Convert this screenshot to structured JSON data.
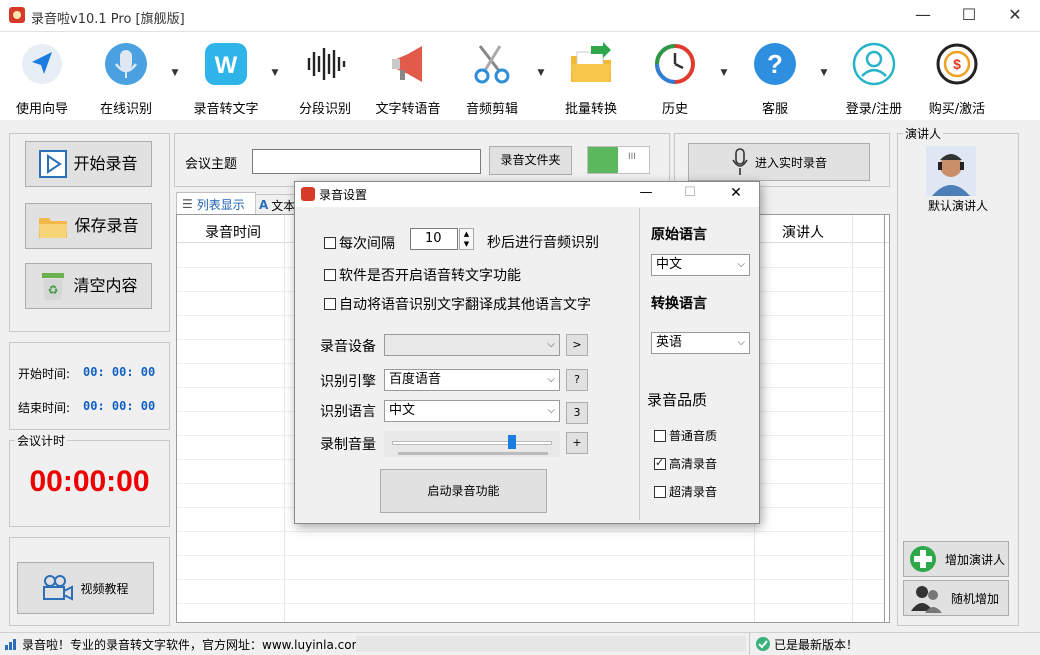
{
  "window": {
    "title": "录音啦v10.1 Pro [旗舰版]",
    "minimize": "—",
    "maximize": "☐",
    "close": "✕"
  },
  "toolbar": {
    "items": [
      {
        "label": "使用向导",
        "icon": "navigation-arrow-icon"
      },
      {
        "label": "在线识别",
        "icon": "microphone-icon"
      },
      {
        "label": "录音转文字",
        "icon": "w-app-icon"
      },
      {
        "label": "分段识别",
        "icon": "waveform-icon"
      },
      {
        "label": "文字转语音",
        "icon": "megaphone-icon"
      },
      {
        "label": "音频剪辑",
        "icon": "scissors-icon"
      },
      {
        "label": "批量转换",
        "icon": "folder-arrow-icon"
      },
      {
        "label": "历史",
        "icon": "history-clock-icon"
      },
      {
        "label": "客服",
        "icon": "help-question-icon"
      },
      {
        "label": "登录/注册",
        "icon": "user-icon"
      },
      {
        "label": "购买/激活",
        "icon": "dollar-coin-icon"
      }
    ]
  },
  "left": {
    "start_record": "开始录音",
    "save_record": "保存录音",
    "clear_content": "清空内容",
    "start_time_label": "开始时间:",
    "start_time_value": "00: 00: 00",
    "end_time_label": "结束时间:",
    "end_time_value": "00: 00: 00",
    "meeting_timer_caption": "会议计时",
    "meeting_timer_value": "00:00:00",
    "video_tutorial": "视频教程"
  },
  "top": {
    "meeting_topic_label": "会议主题",
    "meeting_topic_value": "",
    "record_folder_button": "录音文件夹",
    "toggle_text": "III",
    "realtime_button": "进入实时录音"
  },
  "tabs": [
    {
      "label": "列表显示"
    },
    {
      "label": "文本"
    }
  ],
  "table": {
    "columns": [
      "录音时间",
      "演讲人"
    ]
  },
  "speakers": {
    "caption": "演讲人",
    "default_speaker": "默认演讲人",
    "add_speaker": "增加演讲人",
    "random_add": "随机增加"
  },
  "dialog": {
    "title": "录音设置",
    "minimize": "—",
    "maximize": "☐",
    "close": "✕",
    "every_interval_label": "每次间隔",
    "interval_value": "10",
    "interval_suffix": "秒后进行音频识别",
    "interval_checked": false,
    "auto_start_label": "软件是否开启语音转文字功能",
    "auto_start_checked": false,
    "auto_translate_label": "自动将语音识别文字翻译成其他语言文字",
    "auto_translate_checked": false,
    "device_label": "录音设备",
    "device_value": "",
    "device_btn": ">",
    "engine_label": "识别引擎",
    "engine_value": "百度语音",
    "engine_btn": "?",
    "lang_label": "识别语言",
    "lang_value": "中文",
    "lang_btn": "3",
    "volume_label": "录制音量",
    "volume_level": 0.75,
    "volume_btn": "+",
    "start_button": "启动录音功能",
    "orig_lang_title": "原始语言",
    "orig_lang_value": "中文",
    "target_lang_title": "转换语言",
    "target_lang_value": "英语",
    "quality_title": "录音品质",
    "quality_options": [
      {
        "label": "普通音质",
        "checked": false
      },
      {
        "label": "高清录音",
        "checked": true
      },
      {
        "label": "超清录音",
        "checked": false
      }
    ]
  },
  "status": {
    "left_text": "录音啦！专业的录音转文字软件，官方网址：www.luyinla.com",
    "right_text": "已是最新版本！"
  },
  "colors": {
    "timer_red": "#ee0000",
    "time_blue": "#1060c8",
    "toggle_green": "#5cb85c"
  }
}
